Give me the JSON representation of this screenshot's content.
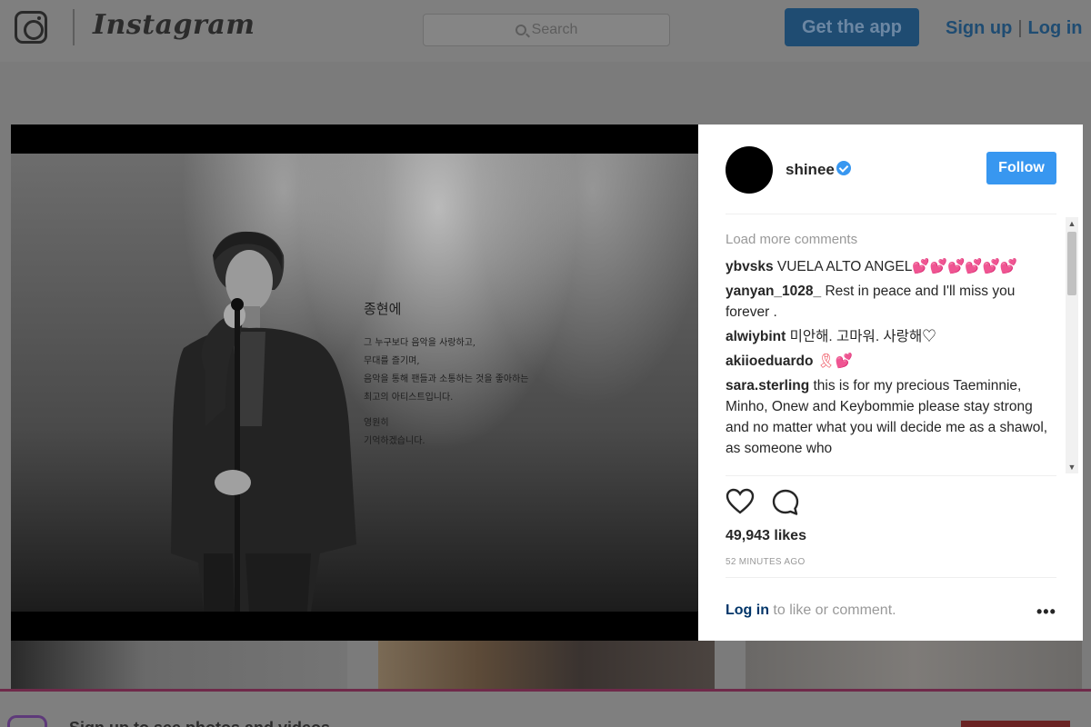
{
  "nav": {
    "wordmark": "Instagram",
    "search_placeholder": "Search",
    "get_app_label": "Get the app",
    "signup_label": "Sign up",
    "separator": "|",
    "login_label": "Log in"
  },
  "post": {
    "tribute": {
      "title": "종현에",
      "lines": [
        "그 누구보다 음악을 사랑하고,",
        "무대를 즐기며,",
        "음악을 통해 팬들과 소통하는 것을 좋아하는",
        "최고의 아티스트입니다.",
        "영원히",
        "기억하겠습니다."
      ]
    }
  },
  "sidebar": {
    "username": "shinee",
    "follow_label": "Follow",
    "load_more": "Load more comments",
    "comments": [
      {
        "user": "ybvsks",
        "text": "VUELA ALTO ANGEL",
        "emoji": "💕💕💕💕💕💕"
      },
      {
        "user": "yanyan_1028_",
        "text": "Rest in peace and I'll miss you forever .",
        "emoji": ""
      },
      {
        "user": "alwiybint",
        "text": "미안해. 고마워. 사랑해♡",
        "emoji": ""
      },
      {
        "user": "akiioeduardo",
        "text": "",
        "emoji": "🎗💕"
      },
      {
        "user": "sara.sterling",
        "text": "this is for my precious Taeminnie, Minho, Onew and Keybommie please stay strong and no matter what you will decide me as a shawol, as someone who",
        "emoji": ""
      }
    ],
    "likes": "49,943 likes",
    "timestamp": "52 MINUTES AGO",
    "login_link": "Log in",
    "login_rest": " to like or comment.",
    "more_label": "•••"
  },
  "bottom_banner": {
    "text": "Sign up to see photos and videos"
  }
}
